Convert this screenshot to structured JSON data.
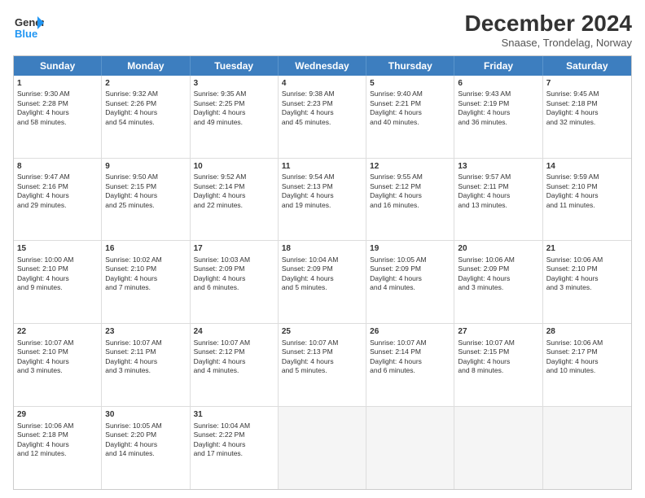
{
  "logo": {
    "line1": "General",
    "line2": "Blue"
  },
  "title": "December 2024",
  "location": "Snaase, Trondelag, Norway",
  "days_header": [
    "Sunday",
    "Monday",
    "Tuesday",
    "Wednesday",
    "Thursday",
    "Friday",
    "Saturday"
  ],
  "weeks": [
    [
      {
        "day": "1",
        "lines": [
          "Sunrise: 9:30 AM",
          "Sunset: 2:28 PM",
          "Daylight: 4 hours",
          "and 58 minutes."
        ]
      },
      {
        "day": "2",
        "lines": [
          "Sunrise: 9:32 AM",
          "Sunset: 2:26 PM",
          "Daylight: 4 hours",
          "and 54 minutes."
        ]
      },
      {
        "day": "3",
        "lines": [
          "Sunrise: 9:35 AM",
          "Sunset: 2:25 PM",
          "Daylight: 4 hours",
          "and 49 minutes."
        ]
      },
      {
        "day": "4",
        "lines": [
          "Sunrise: 9:38 AM",
          "Sunset: 2:23 PM",
          "Daylight: 4 hours",
          "and 45 minutes."
        ]
      },
      {
        "day": "5",
        "lines": [
          "Sunrise: 9:40 AM",
          "Sunset: 2:21 PM",
          "Daylight: 4 hours",
          "and 40 minutes."
        ]
      },
      {
        "day": "6",
        "lines": [
          "Sunrise: 9:43 AM",
          "Sunset: 2:19 PM",
          "Daylight: 4 hours",
          "and 36 minutes."
        ]
      },
      {
        "day": "7",
        "lines": [
          "Sunrise: 9:45 AM",
          "Sunset: 2:18 PM",
          "Daylight: 4 hours",
          "and 32 minutes."
        ]
      }
    ],
    [
      {
        "day": "8",
        "lines": [
          "Sunrise: 9:47 AM",
          "Sunset: 2:16 PM",
          "Daylight: 4 hours",
          "and 29 minutes."
        ]
      },
      {
        "day": "9",
        "lines": [
          "Sunrise: 9:50 AM",
          "Sunset: 2:15 PM",
          "Daylight: 4 hours",
          "and 25 minutes."
        ]
      },
      {
        "day": "10",
        "lines": [
          "Sunrise: 9:52 AM",
          "Sunset: 2:14 PM",
          "Daylight: 4 hours",
          "and 22 minutes."
        ]
      },
      {
        "day": "11",
        "lines": [
          "Sunrise: 9:54 AM",
          "Sunset: 2:13 PM",
          "Daylight: 4 hours",
          "and 19 minutes."
        ]
      },
      {
        "day": "12",
        "lines": [
          "Sunrise: 9:55 AM",
          "Sunset: 2:12 PM",
          "Daylight: 4 hours",
          "and 16 minutes."
        ]
      },
      {
        "day": "13",
        "lines": [
          "Sunrise: 9:57 AM",
          "Sunset: 2:11 PM",
          "Daylight: 4 hours",
          "and 13 minutes."
        ]
      },
      {
        "day": "14",
        "lines": [
          "Sunrise: 9:59 AM",
          "Sunset: 2:10 PM",
          "Daylight: 4 hours",
          "and 11 minutes."
        ]
      }
    ],
    [
      {
        "day": "15",
        "lines": [
          "Sunrise: 10:00 AM",
          "Sunset: 2:10 PM",
          "Daylight: 4 hours",
          "and 9 minutes."
        ]
      },
      {
        "day": "16",
        "lines": [
          "Sunrise: 10:02 AM",
          "Sunset: 2:10 PM",
          "Daylight: 4 hours",
          "and 7 minutes."
        ]
      },
      {
        "day": "17",
        "lines": [
          "Sunrise: 10:03 AM",
          "Sunset: 2:09 PM",
          "Daylight: 4 hours",
          "and 6 minutes."
        ]
      },
      {
        "day": "18",
        "lines": [
          "Sunrise: 10:04 AM",
          "Sunset: 2:09 PM",
          "Daylight: 4 hours",
          "and 5 minutes."
        ]
      },
      {
        "day": "19",
        "lines": [
          "Sunrise: 10:05 AM",
          "Sunset: 2:09 PM",
          "Daylight: 4 hours",
          "and 4 minutes."
        ]
      },
      {
        "day": "20",
        "lines": [
          "Sunrise: 10:06 AM",
          "Sunset: 2:09 PM",
          "Daylight: 4 hours",
          "and 3 minutes."
        ]
      },
      {
        "day": "21",
        "lines": [
          "Sunrise: 10:06 AM",
          "Sunset: 2:10 PM",
          "Daylight: 4 hours",
          "and 3 minutes."
        ]
      }
    ],
    [
      {
        "day": "22",
        "lines": [
          "Sunrise: 10:07 AM",
          "Sunset: 2:10 PM",
          "Daylight: 4 hours",
          "and 3 minutes."
        ]
      },
      {
        "day": "23",
        "lines": [
          "Sunrise: 10:07 AM",
          "Sunset: 2:11 PM",
          "Daylight: 4 hours",
          "and 3 minutes."
        ]
      },
      {
        "day": "24",
        "lines": [
          "Sunrise: 10:07 AM",
          "Sunset: 2:12 PM",
          "Daylight: 4 hours",
          "and 4 minutes."
        ]
      },
      {
        "day": "25",
        "lines": [
          "Sunrise: 10:07 AM",
          "Sunset: 2:13 PM",
          "Daylight: 4 hours",
          "and 5 minutes."
        ]
      },
      {
        "day": "26",
        "lines": [
          "Sunrise: 10:07 AM",
          "Sunset: 2:14 PM",
          "Daylight: 4 hours",
          "and 6 minutes."
        ]
      },
      {
        "day": "27",
        "lines": [
          "Sunrise: 10:07 AM",
          "Sunset: 2:15 PM",
          "Daylight: 4 hours",
          "and 8 minutes."
        ]
      },
      {
        "day": "28",
        "lines": [
          "Sunrise: 10:06 AM",
          "Sunset: 2:17 PM",
          "Daylight: 4 hours",
          "and 10 minutes."
        ]
      }
    ],
    [
      {
        "day": "29",
        "lines": [
          "Sunrise: 10:06 AM",
          "Sunset: 2:18 PM",
          "Daylight: 4 hours",
          "and 12 minutes."
        ]
      },
      {
        "day": "30",
        "lines": [
          "Sunrise: 10:05 AM",
          "Sunset: 2:20 PM",
          "Daylight: 4 hours",
          "and 14 minutes."
        ]
      },
      {
        "day": "31",
        "lines": [
          "Sunrise: 10:04 AM",
          "Sunset: 2:22 PM",
          "Daylight: 4 hours",
          "and 17 minutes."
        ]
      },
      null,
      null,
      null,
      null
    ]
  ]
}
